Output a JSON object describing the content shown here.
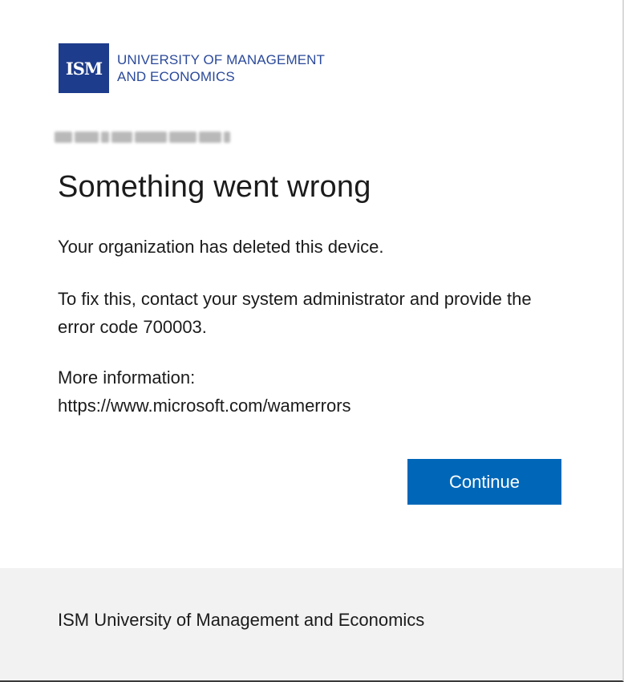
{
  "brand": {
    "mark": "ISM",
    "name_line1": "UNIVERSITY OF MANAGEMENT",
    "name_line2": "AND ECONOMICS",
    "color": "#1e3c8c"
  },
  "error": {
    "title": "Something went wrong",
    "message": "Your organization has deleted this device.",
    "instruction": "To fix this, contact your system administrator and provide the error code 700003.",
    "more_info_label": "More information:",
    "more_info_url": "https://www.microsoft.com/wamerrors"
  },
  "actions": {
    "continue_label": "Continue",
    "accent_color": "#0067b8"
  },
  "footer": {
    "organization": "ISM University of Management and Economics"
  }
}
